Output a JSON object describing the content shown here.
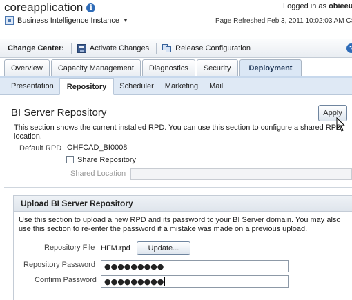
{
  "header": {
    "app_title": "coreapplication",
    "logged_in_prefix": "Logged in as",
    "logged_in_user": "obieeu",
    "instance_label": "Business Intelligence Instance",
    "refreshed": "Page Refreshed Feb 3, 2011 10:02:03 AM CS"
  },
  "change_center": {
    "label": "Change Center:",
    "activate": "Activate Changes",
    "release": "Release Configuration"
  },
  "tabs": [
    {
      "label": "Overview"
    },
    {
      "label": "Capacity Management"
    },
    {
      "label": "Diagnostics"
    },
    {
      "label": "Security"
    },
    {
      "label": "Deployment"
    }
  ],
  "subtabs": [
    {
      "label": "Presentation"
    },
    {
      "label": "Repository"
    },
    {
      "label": "Scheduler"
    },
    {
      "label": "Marketing"
    },
    {
      "label": "Mail"
    }
  ],
  "repository": {
    "heading": "BI Server Repository",
    "apply": "Apply",
    "description": "This section shows the current installed RPD. You can use this section to configure a shared RPD location.",
    "default_rpd_label": "Default RPD",
    "default_rpd_value": "OHFCAD_BI0008",
    "share_label": "Share Repository",
    "shared_location_label": "Shared Location",
    "shared_location_value": ""
  },
  "upload": {
    "heading": "Upload BI Server Repository",
    "description": "Use this section to upload a new RPD and its password to your BI Server domain. You may also use this section to re-enter the password if a mistake was made on a previous upload.",
    "file_label": "Repository File",
    "file_value": "HFM.rpd",
    "update_button": "Update...",
    "password_label": "Repository Password",
    "password_value": "●●●●●●●●●",
    "confirm_label": "Confirm Password",
    "confirm_value": "●●●●●●●●●"
  }
}
